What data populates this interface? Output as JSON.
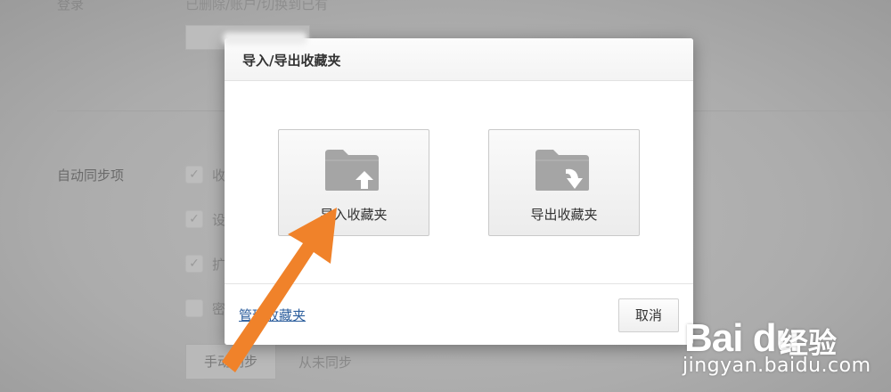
{
  "background": {
    "top_label": "登录",
    "top_text": "已删除/账户/切换到已有",
    "sync_label": "自动同步项",
    "check_items": [
      {
        "label": "收",
        "checked": true
      },
      {
        "label": "设",
        "checked": true
      },
      {
        "label": "扩",
        "checked": true
      },
      {
        "label": "密",
        "checked": false
      }
    ],
    "manual_sync_button": "手动同步",
    "sync_status": "从未同步"
  },
  "dialog": {
    "title": "导入/导出收藏夹",
    "import_label": "导入收藏夹",
    "export_label": "导出收藏夹",
    "manage_link": "管理收藏夹",
    "cancel_label": "取消"
  },
  "annotation": {
    "type": "arrow",
    "color": "#f0822a"
  },
  "watermark": {
    "logo": "Bai du",
    "cn": "经验",
    "url": "jingyan.baidu.com"
  },
  "icons": {
    "import": "folder-upload-icon",
    "export": "folder-download-icon"
  }
}
